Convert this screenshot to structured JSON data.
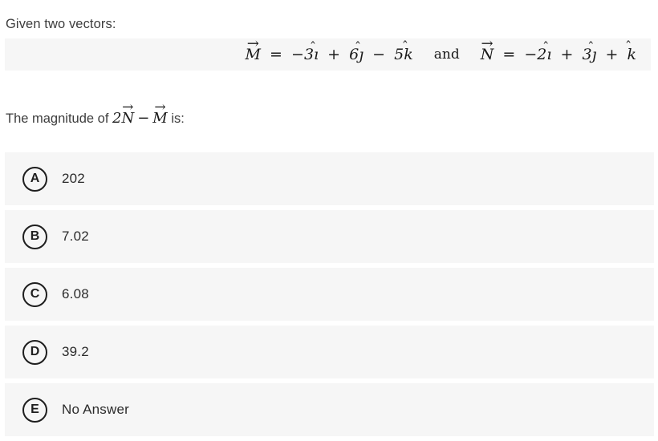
{
  "prompt": {
    "intro": "Given two vectors:",
    "question_prefix": "The magnitude of ",
    "question_suffix": " is:"
  },
  "formula": {
    "vector_m": {
      "name": "M",
      "equals": "=",
      "term1_sign": "−",
      "term1_coeff": "3",
      "term1_unit": "ı",
      "op1": "+",
      "term2_coeff": "6",
      "term2_unit": "ȷ",
      "op2": "−",
      "term3_coeff": "5",
      "term3_unit": "k",
      "full_text": "M⃗ = −3ı̂ + 6ĵ − 5k̂"
    },
    "conjunction": "and",
    "vector_n": {
      "name": "N",
      "equals": "=",
      "term1_sign": "−",
      "term1_coeff": "2",
      "term1_unit": "ı",
      "op1": "+",
      "term2_coeff": "3",
      "term2_unit": "ȷ",
      "op2": "+",
      "term3_coeff": "",
      "term3_unit": "k",
      "full_text": "N⃗ = −2ı̂ + 3ĵ + k̂"
    },
    "arrow_mark": "→",
    "hat_mark": "̂"
  },
  "expression": {
    "coefficient": "2",
    "vector_n": "N",
    "minus": "−",
    "vector_m": "M",
    "arrow_mark": "→",
    "full_text": "2N⃗ − M⃗"
  },
  "options": [
    {
      "letter": "A",
      "label": "202"
    },
    {
      "letter": "B",
      "label": "7.02"
    },
    {
      "letter": "C",
      "label": "6.08"
    },
    {
      "letter": "D",
      "label": "39.2"
    },
    {
      "letter": "E",
      "label": "No Answer"
    }
  ],
  "colors": {
    "page_background": "#ffffff",
    "row_background": "#f6f6f6",
    "text": "#3d3d3d",
    "math_text": "#1b1b1b",
    "badge_border": "#1e1e1e"
  }
}
